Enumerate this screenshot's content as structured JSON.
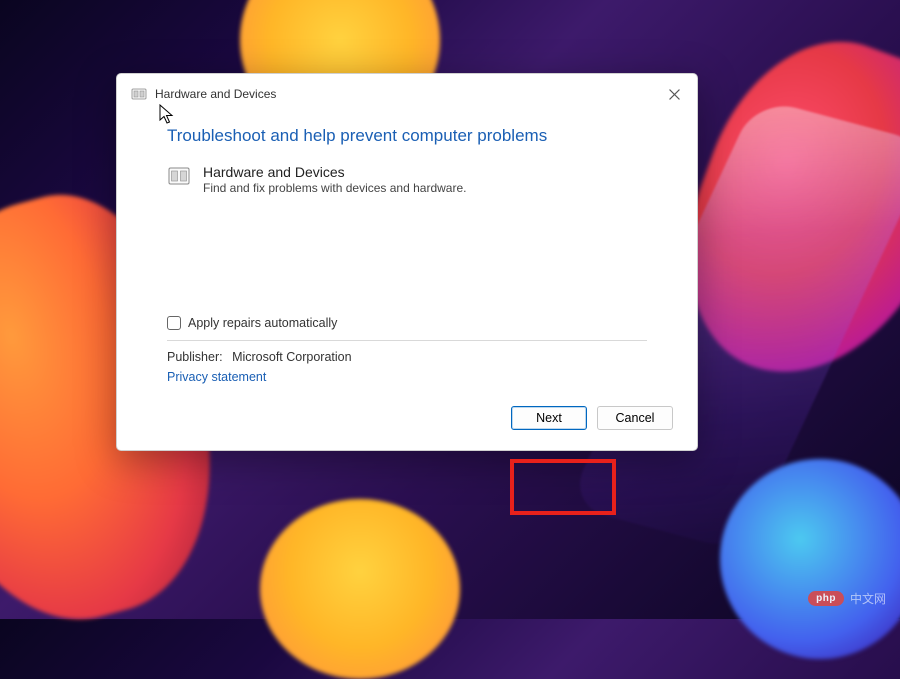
{
  "window": {
    "title": "Hardware and Devices"
  },
  "content": {
    "heading": "Troubleshoot and help prevent computer problems",
    "item": {
      "title": "Hardware and Devices",
      "description": "Find and fix problems with devices and hardware."
    },
    "checkbox_label": "Apply repairs automatically",
    "publisher_label": "Publisher:",
    "publisher_value": "Microsoft Corporation",
    "privacy_link": "Privacy statement"
  },
  "buttons": {
    "next": "Next",
    "cancel": "Cancel"
  },
  "watermark": {
    "pill": "php",
    "text": "中文网"
  }
}
